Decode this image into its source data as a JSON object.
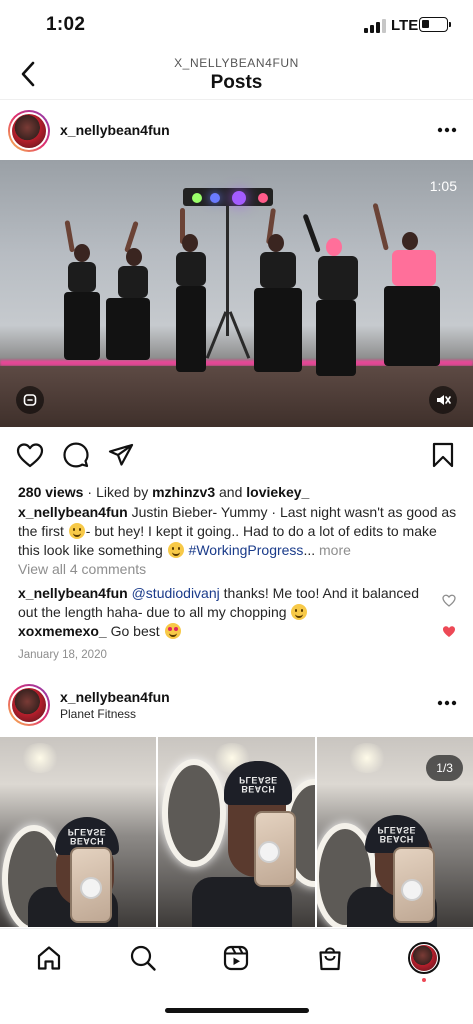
{
  "status_bar": {
    "time": "1:02",
    "network": "LTE",
    "signal_bars_filled": 3,
    "signal_bars_total": 4,
    "battery_level": 0.25
  },
  "header": {
    "subtitle": "X_NELLYBEAN4FUN",
    "title": "Posts"
  },
  "post1": {
    "username": "x_nellybean4fun",
    "video_time": "1:05",
    "views": "280 views",
    "liked_by_prefix": "Liked by",
    "liked_by_user": "mzhinzv3",
    "liked_by_and": "and",
    "liked_by_other": "loviekey_",
    "caption_user": "x_nellybean4fun",
    "caption_text_1": "Justin Bieber- Yummy · Last night wasn't as good as the first",
    "caption_text_2": "- but hey! I kept it going.. Had to do a lot of edits to make this look like something",
    "caption_hashtag": "#WorkingProgress",
    "caption_ellipsis": "...",
    "caption_more": "more",
    "view_comments": "View all 4 comments",
    "comments": [
      {
        "user": "x_nellybean4fun",
        "mention": "@studiodivanj",
        "text": "thanks! Me too! And it balanced out the length haha- due to all my chopping",
        "liked": false
      },
      {
        "user": "xoxmemexo_",
        "mention": "",
        "text": "Go best",
        "liked": true
      }
    ],
    "date": "January 18, 2020"
  },
  "post2": {
    "username": "x_nellybean4fun",
    "location": "Planet Fitness",
    "photo_counter": "1/3",
    "cap_text": "BEACH PLEASE"
  },
  "icons": {
    "back": "chevron-left-icon",
    "more": "ellipsis-icon",
    "like": "heart-icon",
    "comment": "comment-icon",
    "share": "paper-plane-icon",
    "save": "bookmark-icon",
    "mute": "speaker-muted-icon",
    "reels": "reels-icon",
    "home": "home-icon",
    "search": "search-icon",
    "shop": "shopping-bag-icon"
  },
  "colors": {
    "accent_link": "#1a3b8a",
    "like_red": "#ed4956",
    "muted_text": "#8e8e8e"
  }
}
